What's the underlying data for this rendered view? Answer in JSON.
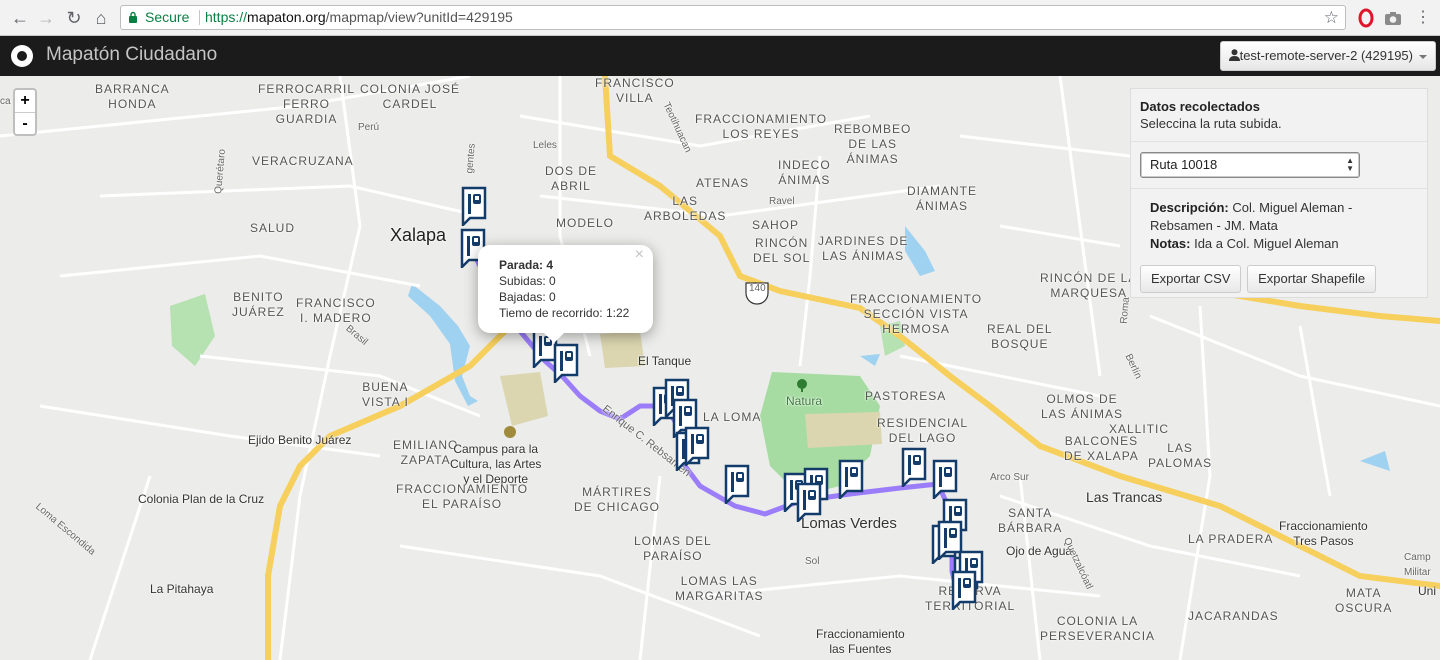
{
  "browser": {
    "secure_label": "Secure",
    "url_scheme": "https://",
    "url_host": "mapaton.org",
    "url_path": "/mapmap/view?unitId=429195"
  },
  "navbar": {
    "brand": "Mapatón Ciudadano",
    "user": "test-remote-server-2 (429195)"
  },
  "zoom": {
    "in": "+",
    "out": "-"
  },
  "popup": {
    "close": "×",
    "stop_label": "Parada:",
    "stop_value": "4",
    "subidas_label": "Subidas:",
    "subidas_value": "0",
    "bajadas_label": "Bajadas:",
    "bajadas_value": "0",
    "tiempo_label": "Tiemo de recorrido:",
    "tiempo_value": "1:22"
  },
  "panel": {
    "title": "Datos recolectados",
    "subtitle": "Seleccina la ruta subida.",
    "route_selected": "Ruta 10018",
    "description_label": "Descripción:",
    "description_value": "Col. Miguel Aleman - Rebsamen - JM. Mata",
    "notes_label": "Notas:",
    "notes_value": "Ida a Col. Miguel Aleman",
    "export_csv": "Exportar CSV",
    "export_shapefile": "Exportar Shapefile"
  },
  "map_labels": [
    {
      "text": "BARRANCA\nHONDA",
      "cls": ""
    },
    {
      "text": "COLONIA JOSÉ\nCARDEL",
      "cls": ""
    },
    {
      "text": "FRANCISCO\nVILLA",
      "cls": ""
    },
    {
      "text": "FERROCARRIL\nFERRO\nGUARDIA",
      "cls": ""
    },
    {
      "text": "FRACCIONAMIENTO\nLOS REYES",
      "cls": ""
    },
    {
      "text": "REBOMBEO\nDE LAS\nÁNIMAS",
      "cls": ""
    },
    {
      "text": "VERACRUZANA",
      "cls": ""
    },
    {
      "text": "DOS DE\nABRIL",
      "cls": ""
    },
    {
      "text": "INDECO\nÁNIMAS",
      "cls": ""
    },
    {
      "text": "ATENAS",
      "cls": ""
    },
    {
      "text": "DIAMANTE\nÁNIMAS",
      "cls": ""
    },
    {
      "text": "SALUD",
      "cls": ""
    },
    {
      "text": "Xalapa",
      "cls": "city"
    },
    {
      "text": "MODELO",
      "cls": ""
    },
    {
      "text": "LAS\nARBOLEDAS",
      "cls": ""
    },
    {
      "text": "SAHOP",
      "cls": ""
    },
    {
      "text": "RINCÓN\nDEL SOL",
      "cls": ""
    },
    {
      "text": "JARDINES DE\nLAS ÁNIMAS",
      "cls": ""
    },
    {
      "text": "RINCÓN DE LA\nMARQUESA",
      "cls": ""
    },
    {
      "text": "BENITO\nJUÁREZ",
      "cls": ""
    },
    {
      "text": "FRANCISCO\nI. MADERO",
      "cls": ""
    },
    {
      "text": "FRACCIONAMIENTO\nSECCIÓN VISTA\nHERMOSA",
      "cls": ""
    },
    {
      "text": "REAL DEL\nBOSQUE",
      "cls": ""
    },
    {
      "text": "El Tanque",
      "cls": "place"
    },
    {
      "text": "BUENA\nVISTA I",
      "cls": ""
    },
    {
      "text": "Natura",
      "cls": "park"
    },
    {
      "text": "PASTORESA",
      "cls": ""
    },
    {
      "text": "OLMOS DE\nLAS ÁNIMAS",
      "cls": ""
    },
    {
      "text": "LA LOMA",
      "cls": ""
    },
    {
      "text": "RESIDENCIAL\nDEL LAGO",
      "cls": ""
    },
    {
      "text": "XALLITIC",
      "cls": ""
    },
    {
      "text": "Ejido Benito Juárez",
      "cls": "place"
    },
    {
      "text": "EMILIANO\nZAPATA",
      "cls": ""
    },
    {
      "text": "Campus para la\nCultura, las Artes\ny el Deporte",
      "cls": "place"
    },
    {
      "text": "BALCONES\nDE XALAPA",
      "cls": ""
    },
    {
      "text": "LAS\nPALOMAS",
      "cls": ""
    },
    {
      "text": "FRACCIONAMIENTO\nEL PARAÍSO",
      "cls": ""
    },
    {
      "text": "Colonia Plan de la Cruz",
      "cls": "place"
    },
    {
      "text": "MÁRTIRES\nDE CHICAGO",
      "cls": ""
    },
    {
      "text": "Lomas Verdes",
      "cls": "city small-city"
    },
    {
      "text": "SANTA\nBÁRBARA",
      "cls": ""
    },
    {
      "text": "Las Trancas",
      "cls": "place big"
    },
    {
      "text": "Fraccionamiento\nTres Pasos",
      "cls": "place"
    },
    {
      "text": "LA PRADERA",
      "cls": ""
    },
    {
      "text": "LOMAS DEL\nPARAÍSO",
      "cls": ""
    },
    {
      "text": "Ojo de Agua",
      "cls": "place"
    },
    {
      "text": "LOMAS LAS\nMARGARITAS",
      "cls": ""
    },
    {
      "text": "RESERVA\nTERRITORIAL",
      "cls": ""
    },
    {
      "text": "La Pitahaya",
      "cls": "place"
    },
    {
      "text": "COLONIA LA\nPERSEVERANCIA",
      "cls": ""
    },
    {
      "text": "JACARANDAS",
      "cls": ""
    },
    {
      "text": "MATA\nOSCURA",
      "cls": ""
    },
    {
      "text": "Fraccionamiento\nlas Fuentes",
      "cls": "place"
    },
    {
      "text": "Camp\nMilitar",
      "cls": "small"
    },
    {
      "text": "Uni",
      "cls": "place"
    },
    {
      "text": "Enrique C. Rebsamen",
      "cls": "small"
    },
    {
      "text": "Arco Sur",
      "cls": "small"
    },
    {
      "text": "Perú",
      "cls": "small"
    },
    {
      "text": "Querétaro",
      "cls": "small"
    },
    {
      "text": "Brasil",
      "cls": "small"
    },
    {
      "text": "Leles",
      "cls": "small"
    },
    {
      "text": "Teotihuacan",
      "cls": "small"
    },
    {
      "text": "Ravel",
      "cls": "small"
    },
    {
      "text": "Roma",
      "cls": "small"
    },
    {
      "text": "Berlín",
      "cls": "small"
    },
    {
      "text": "Loma Escondida",
      "cls": "small"
    },
    {
      "text": "Sol",
      "cls": "small"
    },
    {
      "text": "Quetzalcóatl",
      "cls": "small"
    },
    {
      "text": "gentes",
      "cls": "small"
    },
    {
      "text": "ca",
      "cls": "small"
    },
    {
      "text": "140",
      "cls": "small"
    }
  ]
}
